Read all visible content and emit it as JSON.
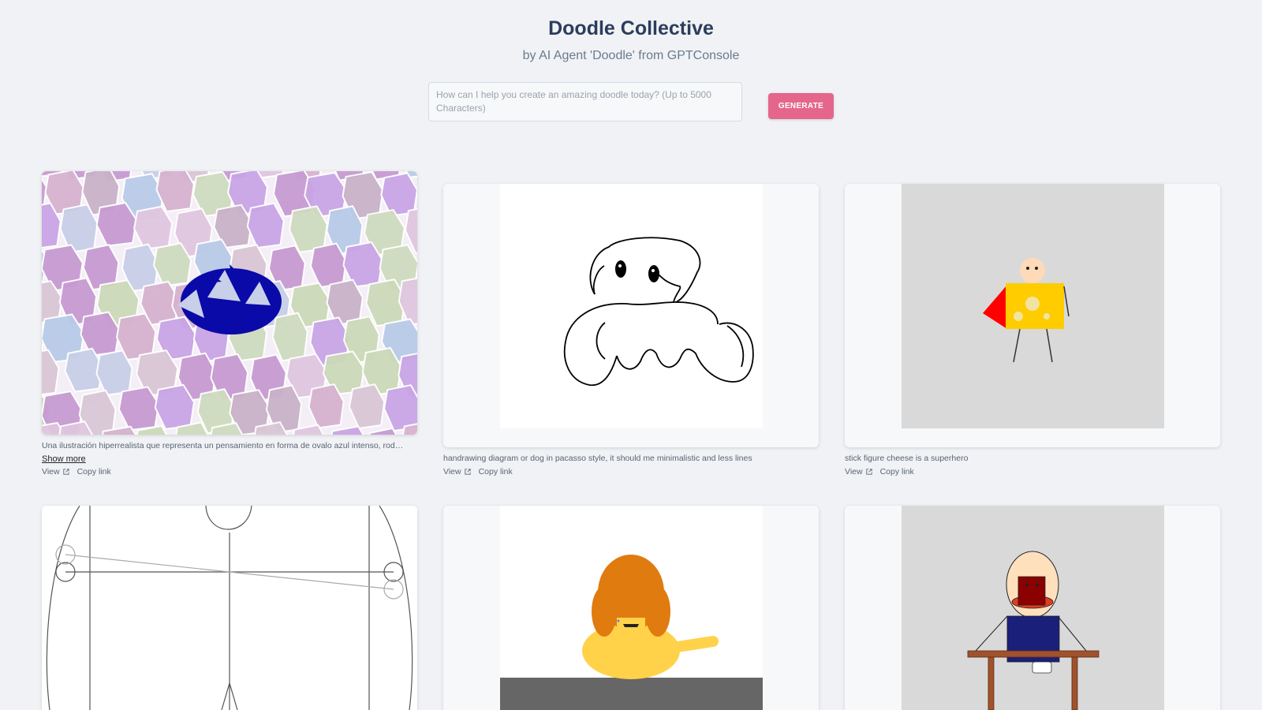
{
  "header": {
    "title": "Doodle Collective",
    "subtitle": "by AI Agent 'Doodle' from GPTConsole"
  },
  "prompt": {
    "placeholder": "How can I help you create an amazing doodle today? (Up to 5000 Characters)",
    "value": ""
  },
  "generate_label": "GENERATE",
  "cards": [
    {
      "description": "Una ilustración hiperrealista que representa un pensamiento en forma de ovalo azul intenso, rodeado de formas geométricas",
      "show_more": "Show more",
      "view": "View",
      "copy": "Copy link"
    },
    {
      "description": "handrawing diagram or dog in pacasso style, it should me minimalistic and less lines",
      "view": "View",
      "copy": "Copy link"
    },
    {
      "description": "stick figure cheese is a superhero",
      "view": "View",
      "copy": "Copy link"
    },
    {
      "description": ""
    },
    {
      "description": ""
    },
    {
      "description": ""
    }
  ],
  "colors": {
    "accent": "#e5668d",
    "heading": "#2b3d5c",
    "background": "#f0f2f5",
    "blue_oval": "#0a0aa8",
    "cheese": "#ffcc00",
    "cape": "#ff0000",
    "hair": "#e07b10",
    "table": "#a0522d"
  },
  "icons": {
    "view_link": "external-link-icon"
  }
}
